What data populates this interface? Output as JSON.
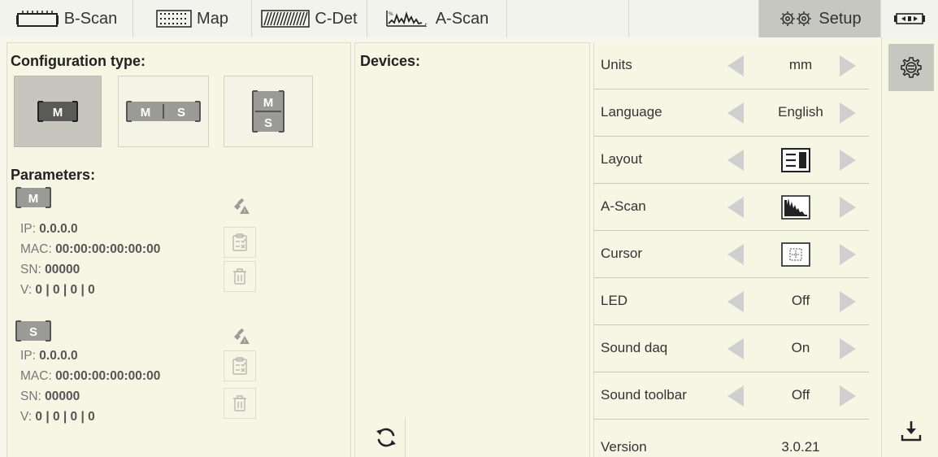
{
  "tabs": {
    "bscan": "B-Scan",
    "map": "Map",
    "cdet": "C-Det",
    "ascan": "A-Scan",
    "setup": "Setup"
  },
  "left": {
    "config_title": "Configuration type:",
    "params_title": "Parameters:",
    "badge_m": "M",
    "badge_s": "S",
    "master": {
      "ip_label": "IP: ",
      "ip": "0.0.0.0",
      "mac_label": "MAC: ",
      "mac": "00:00:00:00:00:00",
      "sn_label": "SN: ",
      "sn": "00000",
      "v_label": "V: ",
      "v": "0 | 0 | 0 | 0"
    },
    "slave": {
      "ip_label": "IP: ",
      "ip": "0.0.0.0",
      "mac_label": "MAC: ",
      "mac": "00:00:00:00:00:00",
      "sn_label": "SN: ",
      "sn": "00000",
      "v_label": "V: ",
      "v": "0 | 0 | 0 | 0"
    }
  },
  "middle": {
    "devices_title": "Devices:"
  },
  "settings": {
    "units": {
      "label": "Units",
      "value": "mm"
    },
    "language": {
      "label": "Language",
      "value": "English"
    },
    "layout": {
      "label": "Layout",
      "icon": "layout-icon"
    },
    "ascan": {
      "label": "A-Scan",
      "icon": "ascan-filled-icon"
    },
    "cursor": {
      "label": "Cursor",
      "icon": "cursor-icon"
    },
    "led": {
      "label": "LED",
      "value": "Off"
    },
    "sound_daq": {
      "label": "Sound daq",
      "value": "On"
    },
    "sound_toolbar": {
      "label": "Sound toolbar",
      "value": "Off"
    },
    "version": {
      "label": "Version",
      "value": "3.0.21"
    }
  },
  "colors": {
    "background": "#f6f6e5",
    "active_tab": "#c7c7c2",
    "arrow": "#cfcfcf",
    "badge": "#9a9a96"
  }
}
